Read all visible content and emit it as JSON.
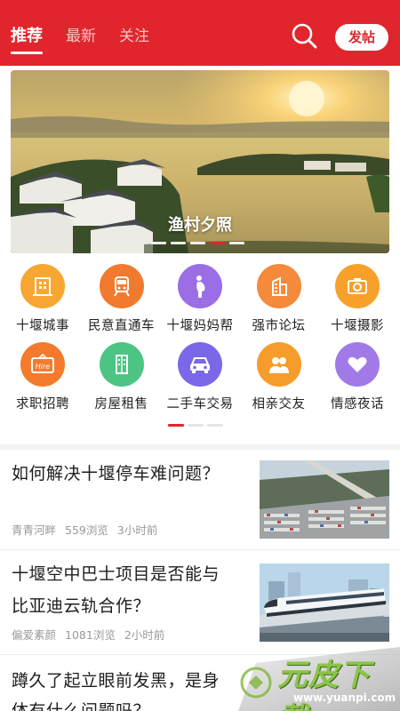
{
  "header": {
    "tabs": [
      {
        "label": "推荐",
        "active": true
      },
      {
        "label": "最新",
        "active": false
      },
      {
        "label": "关注",
        "active": false
      }
    ],
    "post_label": "发帖",
    "accent_color": "#e0262c"
  },
  "banner": {
    "title": "渔村夕照",
    "slide_count": 5,
    "active_slide": 4
  },
  "grid": {
    "items": [
      {
        "label": "十堰城事",
        "icon": "building-icon",
        "color": "#f7a632"
      },
      {
        "label": "民意直通车",
        "icon": "train-icon",
        "color": "#f27a2e"
      },
      {
        "label": "十堰妈妈帮",
        "icon": "pregnant-mother-icon",
        "color": "#9b6ee6"
      },
      {
        "label": "强市论坛",
        "icon": "office-building-icon",
        "color": "#f48a3a"
      },
      {
        "label": "十堰摄影",
        "icon": "camera-icon",
        "color": "#f7a12a"
      },
      {
        "label": "求职招聘",
        "icon": "hire-sign-icon",
        "color": "#f47b2d"
      },
      {
        "label": "房屋租售",
        "icon": "apartment-icon",
        "color": "#4cc484"
      },
      {
        "label": "二手车交易",
        "icon": "car-icon",
        "color": "#7a68e8"
      },
      {
        "label": "相亲交友",
        "icon": "couple-icon",
        "color": "#f59c2b"
      },
      {
        "label": "情感夜话",
        "icon": "heart-icon",
        "color": "#a27ae8"
      }
    ],
    "page_count": 3,
    "active_page": 1
  },
  "news": [
    {
      "title_lines": [
        "如何解决十堰停车难问题？"
      ],
      "author": "青青河畔",
      "views": "559浏览",
      "time": "3小时前",
      "thumb": "parking-lot-aerial-image"
    },
    {
      "title_lines": [
        "十堰空中巴士项目是否能与",
        "比亚迪云轨合作？"
      ],
      "author": "偏爱素颜",
      "views": "1081浏览",
      "time": "2小时前",
      "thumb": "monorail-train-image"
    },
    {
      "title_lines": [
        "蹲久了起立眼前发黑，是身",
        "体有什么问题吗？"
      ]
    }
  ],
  "watermark": {
    "brand": "元皮下载",
    "url": "www.yuanpi.com"
  }
}
